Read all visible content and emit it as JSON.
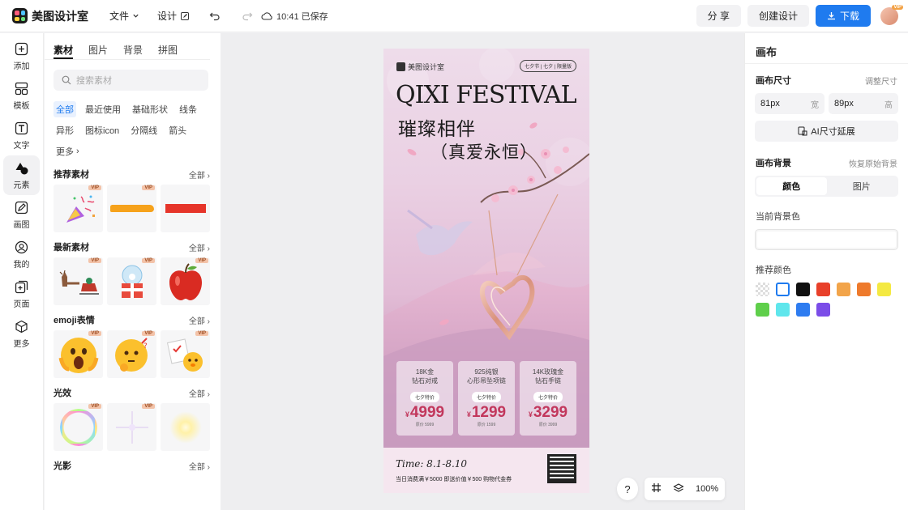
{
  "app": {
    "name": "美图设计室"
  },
  "topbar": {
    "menu_file": "文件",
    "menu_design": "设计",
    "save_status": "10:41 已保存",
    "share": "分 享",
    "create": "创建设计",
    "download": "下载",
    "avatar_badge": "VIP"
  },
  "rail": {
    "items": [
      {
        "label": "添加",
        "icon": "plus-square-icon"
      },
      {
        "label": "模板",
        "icon": "template-icon"
      },
      {
        "label": "文字",
        "icon": "text-icon"
      },
      {
        "label": "元素",
        "icon": "shapes-icon"
      },
      {
        "label": "画图",
        "icon": "draw-icon"
      },
      {
        "label": "我的",
        "icon": "user-icon"
      },
      {
        "label": "页面",
        "icon": "add-page-icon"
      },
      {
        "label": "更多",
        "icon": "cube-icon"
      }
    ],
    "active": "元素"
  },
  "panel": {
    "tabs": [
      "素材",
      "图片",
      "背景",
      "拼图"
    ],
    "active_tab": "素材",
    "search_placeholder": "搜索素材",
    "chips": [
      "全部",
      "最近使用",
      "基础形状",
      "线条",
      "异形",
      "图标icon",
      "分隔线",
      "箭头",
      "更多"
    ],
    "active_chip": "全部",
    "all_label": "全部",
    "vip": "VIP",
    "sections": [
      {
        "title": "推荐素材"
      },
      {
        "title": "最新素材"
      },
      {
        "title": "emoji表情"
      },
      {
        "title": "光效"
      },
      {
        "title": "光影"
      }
    ]
  },
  "poster": {
    "logo": "美图设计室",
    "tag": "七夕节 | 七夕 | 限量版",
    "title": "QIXI FESTIVAL",
    "headline1": "璀璨相伴",
    "headline2": "（真爱永恒）",
    "cards": [
      {
        "name1": "18K金",
        "name2": "钻石对戒",
        "badge": "七夕特价",
        "currency": "¥",
        "price": "4999",
        "note": "原价 5999"
      },
      {
        "name1": "925纯银",
        "name2": "心形吊坠项链",
        "badge": "七夕特价",
        "currency": "¥",
        "price": "1299",
        "note": "原价 1599"
      },
      {
        "name1": "14K玫瑰金",
        "name2": "钻石手链",
        "badge": "七夕特价",
        "currency": "¥",
        "price": "3299",
        "note": "原价 3999"
      }
    ],
    "time": "Time: 8.1-8.10",
    "footer": "当日消费满￥5000 即送价值￥500 购物代金券"
  },
  "floating": {
    "help": "?",
    "zoom": "100%"
  },
  "right": {
    "title": "画布",
    "size_label": "画布尺寸",
    "size_link": "调整尺寸",
    "width_value": "81px",
    "width_unit": "宽",
    "height_value": "89px",
    "height_unit": "高",
    "ai_extend": "AI尺寸延展",
    "bg_label": "画布背景",
    "bg_link": "恢复原始背景",
    "seg_color": "颜色",
    "seg_image": "图片",
    "current_bg": "当前背景色",
    "recommended": "推荐颜色",
    "colors": [
      "transparent",
      "#ffffff",
      "#111111",
      "#e8402a",
      "#f2a44a",
      "#ee7a2c",
      "#f4e942",
      "#5fcf4b",
      "#5fe6ec",
      "#2e7cf0",
      "#7b4de8"
    ]
  }
}
